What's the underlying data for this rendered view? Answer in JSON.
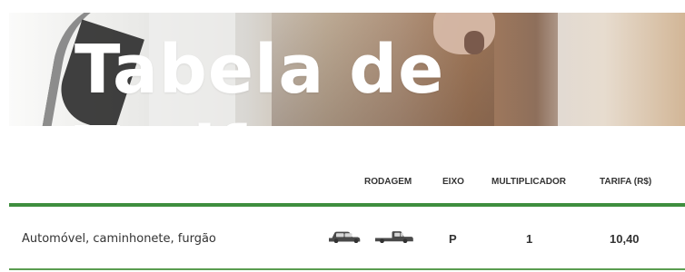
{
  "banner": {
    "title": "Tabela de Tarifas"
  },
  "table": {
    "headers": {
      "rodagem": "RODAGEM",
      "eixo": "EIXO",
      "multiplicador": "MULTIPLICADOR",
      "tarifa": "TARIFA (R$)"
    },
    "row": {
      "vehicle": "Automóvel, caminhonete, furgão",
      "eixo": "P",
      "multiplicador": "1",
      "tarifa": "10,40",
      "icons": [
        "car-icon",
        "pickup-truck-icon"
      ]
    }
  },
  "colors": {
    "accent": "#3e8e3e",
    "text": "#333333"
  }
}
